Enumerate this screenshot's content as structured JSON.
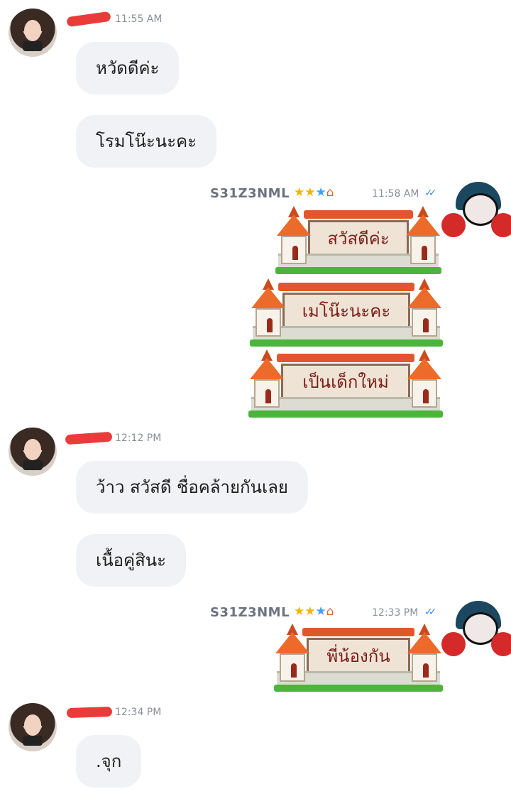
{
  "messages": [
    {
      "type": "other_header",
      "time": "11:55 AM"
    },
    {
      "type": "other_text",
      "text": "หวัดดีค่ะ"
    },
    {
      "type": "other_text",
      "text": "โรมโน๊ะนะคะ"
    },
    {
      "type": "me_header",
      "sender": "S31Z3NML",
      "badges": "⭐⭐⭐🏠",
      "time": "11:58 AM",
      "status": "✓✓"
    },
    {
      "type": "sticker",
      "text": "สวัสดีค่ะ"
    },
    {
      "type": "sticker",
      "text": "เมโน๊ะนะคะ"
    },
    {
      "type": "sticker",
      "text": "เป็นเด็กใหม่"
    },
    {
      "type": "other_header",
      "time": "12:12 PM"
    },
    {
      "type": "other_text",
      "text": "ว้าว สวัสดี ชื่อคล้ายกันเลย"
    },
    {
      "type": "other_text",
      "text": "เนื้อคู่สินะ"
    },
    {
      "type": "me_header",
      "sender": "S31Z3NML",
      "badges": "⭐⭐⭐🏠",
      "time": "12:33 PM",
      "status": "✓✓"
    },
    {
      "type": "sticker",
      "text": "พี่น้องกัน"
    },
    {
      "type": "other_header",
      "time": "12:34 PM"
    },
    {
      "type": "other_text",
      "text": ".จุก"
    }
  ],
  "colors": {
    "bubble": "#f1f2f5",
    "scribble": "#e8322f",
    "timestamp": "#8a8f98",
    "read_ticks": "#3b8cf5",
    "sender": "#6b7380",
    "sticker_text": "#7a1f16"
  },
  "icons": [
    "avatar-other",
    "avatar-me",
    "read-receipt-icon",
    "star-badge-icon",
    "house-badge-icon"
  ]
}
